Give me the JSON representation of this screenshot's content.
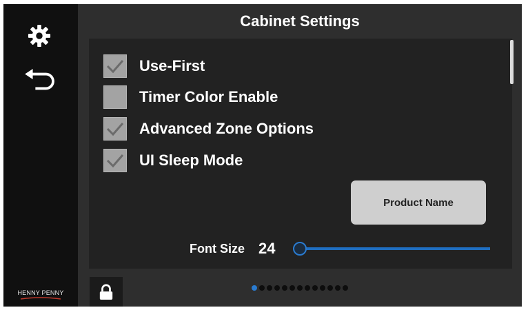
{
  "header": {
    "title": "Cabinet Settings"
  },
  "sidebar": {
    "settings_icon": "gear-icon",
    "back_icon": "back-arrow-icon",
    "brand": "HENNY PENNY"
  },
  "options": [
    {
      "label": "Use-First",
      "checked": true
    },
    {
      "label": "Timer Color Enable",
      "checked": false
    },
    {
      "label": "Advanced Zone Options",
      "checked": true
    },
    {
      "label": "UI Sleep Mode",
      "checked": true
    }
  ],
  "product_button": {
    "label": "Product Name"
  },
  "font_size": {
    "label": "Font Size",
    "value": "24",
    "slider_fraction": 0.0
  },
  "footer": {
    "lock_icon": "lock-icon",
    "page_count": 13,
    "active_page": 1
  },
  "colors": {
    "accent": "#2a7bd0",
    "background": "#2e2e2e",
    "panel": "#222222",
    "sidebar": "#101010",
    "checkbox": "#a3a3a3"
  }
}
